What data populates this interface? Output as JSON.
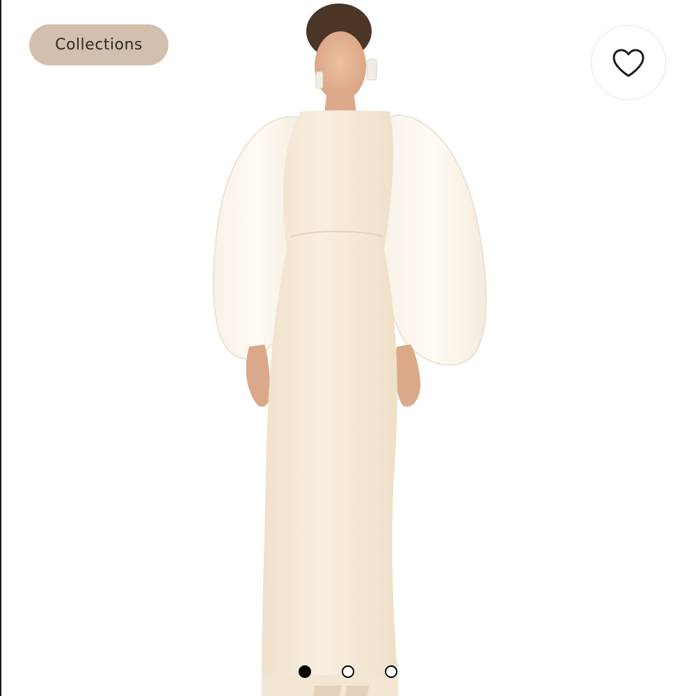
{
  "app": {
    "background": "#ffffff"
  },
  "header": {
    "collections_label": "Collections",
    "collections_color": "#d3bfad"
  },
  "like": {
    "icon": "heart-outline-icon",
    "liked": false
  },
  "product_image": {
    "dress_color": "#f6ead8",
    "sleeve_color": "#fbf5ec",
    "skin_color": "#e3b393",
    "hair_color": "#4a3526"
  },
  "pager": {
    "total": 3,
    "active_index": 0,
    "dots": [
      {
        "state": "active"
      },
      {
        "state": "inactive"
      },
      {
        "state": "inactive"
      }
    ]
  }
}
